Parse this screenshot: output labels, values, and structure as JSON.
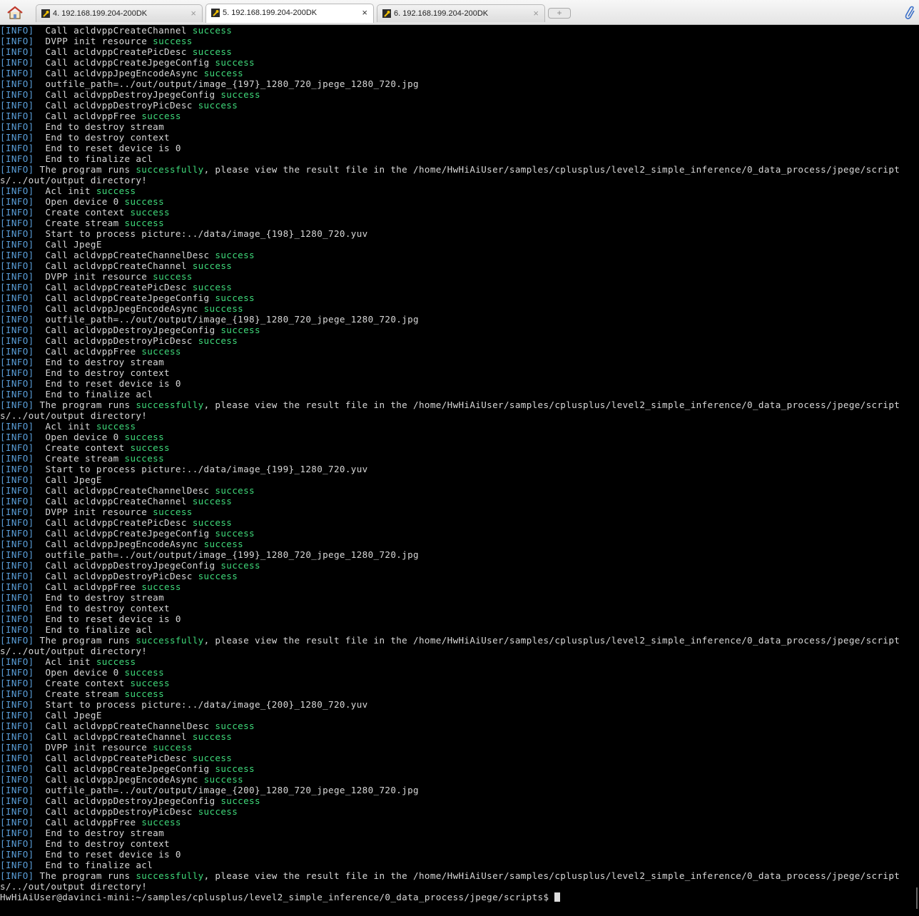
{
  "tabs": [
    {
      "label": "4. 192.168.199.204-200DK",
      "active": false
    },
    {
      "label": "5. 192.168.199.204-200DK",
      "active": true
    },
    {
      "label": "6. 192.168.199.204-200DK",
      "active": false
    }
  ],
  "icons": {
    "home": "home-icon",
    "tab": "wrench-icon",
    "new_tab": "plus-icon",
    "attach": "paperclip-icon"
  },
  "new_tab_label": "+",
  "colors": {
    "background": "#000000",
    "text": "#d8d8d8",
    "info_tag": "#5a9ed8",
    "success": "#3fd97a"
  },
  "tag": "[INFO]",
  "success_word": "success",
  "prompt": "HwHiAiUser@davinci-mini:~/samples/cplusplus/level2_simple_inference/0_data_process/jpege/scripts$ ",
  "lines": [
    {
      "tag": "[INFO]",
      "text": "  Call acldvppCreateChannel ",
      "ok": "success"
    },
    {
      "tag": "[INFO]",
      "text": "  DVPP init resource ",
      "ok": "success"
    },
    {
      "tag": "[INFO]",
      "text": "  Call acldvppCreatePicDesc ",
      "ok": "success"
    },
    {
      "tag": "[INFO]",
      "text": "  Call acldvppCreateJpegeConfig ",
      "ok": "success"
    },
    {
      "tag": "[INFO]",
      "text": "  Call acldvppJpegEncodeAsync ",
      "ok": "success"
    },
    {
      "tag": "[INFO]",
      "text": "  outfile_path=../out/output/image_{197}_1280_720_jpege_1280_720.jpg"
    },
    {
      "tag": "[INFO]",
      "text": "  Call acldvppDestroyJpegeConfig ",
      "ok": "success"
    },
    {
      "tag": "[INFO]",
      "text": "  Call acldvppDestroyPicDesc ",
      "ok": "success"
    },
    {
      "tag": "[INFO]",
      "text": "  Call acldvppFree ",
      "ok": "success"
    },
    {
      "tag": "[INFO]",
      "text": "  End to destroy stream"
    },
    {
      "tag": "[INFO]",
      "text": "  End to destroy context"
    },
    {
      "tag": "[INFO]",
      "text": "  End to reset device is 0"
    },
    {
      "tag": "[INFO]",
      "text": "  End to finalize acl"
    },
    {
      "tag": "[INFO]",
      "text": " The program runs ",
      "ok": "successfully",
      "rest": ", please view the result file in the /home/HwHiAiUser/samples/cplusplus/level2_simple_inference/0_data_process/jpege/script"
    },
    {
      "text": "s/../out/output directory!"
    },
    {
      "tag": "[INFO]",
      "text": "  Acl init ",
      "ok": "success"
    },
    {
      "tag": "[INFO]",
      "text": "  Open device 0 ",
      "ok": "success"
    },
    {
      "tag": "[INFO]",
      "text": "  Create context ",
      "ok": "success"
    },
    {
      "tag": "[INFO]",
      "text": "  Create stream ",
      "ok": "success"
    },
    {
      "tag": "[INFO]",
      "text": "  Start to process picture:../data/image_{198}_1280_720.yuv"
    },
    {
      "tag": "[INFO]",
      "text": "  Call JpegE"
    },
    {
      "tag": "[INFO]",
      "text": "  Call acldvppCreateChannelDesc ",
      "ok": "success"
    },
    {
      "tag": "[INFO]",
      "text": "  Call acldvppCreateChannel ",
      "ok": "success"
    },
    {
      "tag": "[INFO]",
      "text": "  DVPP init resource ",
      "ok": "success"
    },
    {
      "tag": "[INFO]",
      "text": "  Call acldvppCreatePicDesc ",
      "ok": "success"
    },
    {
      "tag": "[INFO]",
      "text": "  Call acldvppCreateJpegeConfig ",
      "ok": "success"
    },
    {
      "tag": "[INFO]",
      "text": "  Call acldvppJpegEncodeAsync ",
      "ok": "success"
    },
    {
      "tag": "[INFO]",
      "text": "  outfile_path=../out/output/image_{198}_1280_720_jpege_1280_720.jpg"
    },
    {
      "tag": "[INFO]",
      "text": "  Call acldvppDestroyJpegeConfig ",
      "ok": "success"
    },
    {
      "tag": "[INFO]",
      "text": "  Call acldvppDestroyPicDesc ",
      "ok": "success"
    },
    {
      "tag": "[INFO]",
      "text": "  Call acldvppFree ",
      "ok": "success"
    },
    {
      "tag": "[INFO]",
      "text": "  End to destroy stream"
    },
    {
      "tag": "[INFO]",
      "text": "  End to destroy context"
    },
    {
      "tag": "[INFO]",
      "text": "  End to reset device is 0"
    },
    {
      "tag": "[INFO]",
      "text": "  End to finalize acl"
    },
    {
      "tag": "[INFO]",
      "text": " The program runs ",
      "ok": "successfully",
      "rest": ", please view the result file in the /home/HwHiAiUser/samples/cplusplus/level2_simple_inference/0_data_process/jpege/script"
    },
    {
      "text": "s/../out/output directory!"
    },
    {
      "tag": "[INFO]",
      "text": "  Acl init ",
      "ok": "success"
    },
    {
      "tag": "[INFO]",
      "text": "  Open device 0 ",
      "ok": "success"
    },
    {
      "tag": "[INFO]",
      "text": "  Create context ",
      "ok": "success"
    },
    {
      "tag": "[INFO]",
      "text": "  Create stream ",
      "ok": "success"
    },
    {
      "tag": "[INFO]",
      "text": "  Start to process picture:../data/image_{199}_1280_720.yuv"
    },
    {
      "tag": "[INFO]",
      "text": "  Call JpegE"
    },
    {
      "tag": "[INFO]",
      "text": "  Call acldvppCreateChannelDesc ",
      "ok": "success"
    },
    {
      "tag": "[INFO]",
      "text": "  Call acldvppCreateChannel ",
      "ok": "success"
    },
    {
      "tag": "[INFO]",
      "text": "  DVPP init resource ",
      "ok": "success"
    },
    {
      "tag": "[INFO]",
      "text": "  Call acldvppCreatePicDesc ",
      "ok": "success"
    },
    {
      "tag": "[INFO]",
      "text": "  Call acldvppCreateJpegeConfig ",
      "ok": "success"
    },
    {
      "tag": "[INFO]",
      "text": "  Call acldvppJpegEncodeAsync ",
      "ok": "success"
    },
    {
      "tag": "[INFO]",
      "text": "  outfile_path=../out/output/image_{199}_1280_720_jpege_1280_720.jpg"
    },
    {
      "tag": "[INFO]",
      "text": "  Call acldvppDestroyJpegeConfig ",
      "ok": "success"
    },
    {
      "tag": "[INFO]",
      "text": "  Call acldvppDestroyPicDesc ",
      "ok": "success"
    },
    {
      "tag": "[INFO]",
      "text": "  Call acldvppFree ",
      "ok": "success"
    },
    {
      "tag": "[INFO]",
      "text": "  End to destroy stream"
    },
    {
      "tag": "[INFO]",
      "text": "  End to destroy context"
    },
    {
      "tag": "[INFO]",
      "text": "  End to reset device is 0"
    },
    {
      "tag": "[INFO]",
      "text": "  End to finalize acl"
    },
    {
      "tag": "[INFO]",
      "text": " The program runs ",
      "ok": "successfully",
      "rest": ", please view the result file in the /home/HwHiAiUser/samples/cplusplus/level2_simple_inference/0_data_process/jpege/script"
    },
    {
      "text": "s/../out/output directory!"
    },
    {
      "tag": "[INFO]",
      "text": "  Acl init ",
      "ok": "success"
    },
    {
      "tag": "[INFO]",
      "text": "  Open device 0 ",
      "ok": "success"
    },
    {
      "tag": "[INFO]",
      "text": "  Create context ",
      "ok": "success"
    },
    {
      "tag": "[INFO]",
      "text": "  Create stream ",
      "ok": "success"
    },
    {
      "tag": "[INFO]",
      "text": "  Start to process picture:../data/image_{200}_1280_720.yuv"
    },
    {
      "tag": "[INFO]",
      "text": "  Call JpegE"
    },
    {
      "tag": "[INFO]",
      "text": "  Call acldvppCreateChannelDesc ",
      "ok": "success"
    },
    {
      "tag": "[INFO]",
      "text": "  Call acldvppCreateChannel ",
      "ok": "success"
    },
    {
      "tag": "[INFO]",
      "text": "  DVPP init resource ",
      "ok": "success"
    },
    {
      "tag": "[INFO]",
      "text": "  Call acldvppCreatePicDesc ",
      "ok": "success"
    },
    {
      "tag": "[INFO]",
      "text": "  Call acldvppCreateJpegeConfig ",
      "ok": "success"
    },
    {
      "tag": "[INFO]",
      "text": "  Call acldvppJpegEncodeAsync ",
      "ok": "success"
    },
    {
      "tag": "[INFO]",
      "text": "  outfile_path=../out/output/image_{200}_1280_720_jpege_1280_720.jpg"
    },
    {
      "tag": "[INFO]",
      "text": "  Call acldvppDestroyJpegeConfig ",
      "ok": "success"
    },
    {
      "tag": "[INFO]",
      "text": "  Call acldvppDestroyPicDesc ",
      "ok": "success"
    },
    {
      "tag": "[INFO]",
      "text": "  Call acldvppFree ",
      "ok": "success"
    },
    {
      "tag": "[INFO]",
      "text": "  End to destroy stream"
    },
    {
      "tag": "[INFO]",
      "text": "  End to destroy context"
    },
    {
      "tag": "[INFO]",
      "text": "  End to reset device is 0"
    },
    {
      "tag": "[INFO]",
      "text": "  End to finalize acl"
    },
    {
      "tag": "[INFO]",
      "text": " The program runs ",
      "ok": "successfully",
      "rest": ", please view the result file in the /home/HwHiAiUser/samples/cplusplus/level2_simple_inference/0_data_process/jpege/script"
    },
    {
      "text": "s/../out/output directory!"
    }
  ]
}
